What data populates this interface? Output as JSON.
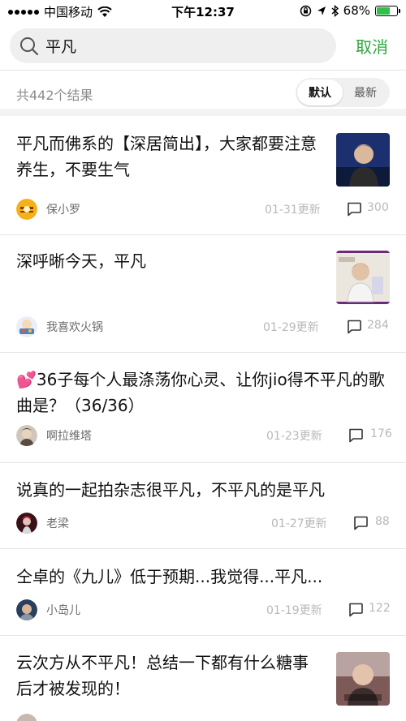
{
  "status_bar": {
    "carrier": "中国移动",
    "time": "下午12:37",
    "battery": "68%",
    "battery_level": 0.68,
    "icons": [
      "signal-icon",
      "wifi-icon",
      "rotation-lock-icon",
      "location-icon",
      "bluetooth-icon",
      "battery-icon"
    ]
  },
  "search": {
    "query": "平凡",
    "cancel_label": "取消"
  },
  "results": {
    "count_label": "共442个结果",
    "sort_options": [
      "默认",
      "最新"
    ],
    "sort_selected": "默认"
  },
  "colors": {
    "accent": "#2aa83b",
    "muted": "#b8b8b8"
  },
  "posts": [
    {
      "title": "平凡而佛系的【深居简出】，大家都要注意养生，不要生气",
      "author": "保小罗",
      "date": "01-31更新",
      "comments": "300"
    },
    {
      "title": "深呼晰今天，平凡",
      "author": "我喜欢火锅",
      "date": "01-29更新",
      "comments": "284"
    },
    {
      "emoji": "💕",
      "title": "36子每个人最涤荡你心灵、让你jio得不平凡的歌曲是？（36/36）",
      "author": "啊拉维塔",
      "date": "01-23更新",
      "comments": "176"
    },
    {
      "title": "说真的一起拍杂志很平凡，不平凡的是平凡",
      "author": "老梁",
      "date": "01-27更新",
      "comments": "88"
    },
    {
      "title": "仝卓的《九儿》低于预期...我觉得...平凡...",
      "author": "小岛儿",
      "date": "01-19更新",
      "comments": "122"
    },
    {
      "title": "云次方从不平凡！总结一下都有什么糖事后才被发现的！"
    }
  ]
}
